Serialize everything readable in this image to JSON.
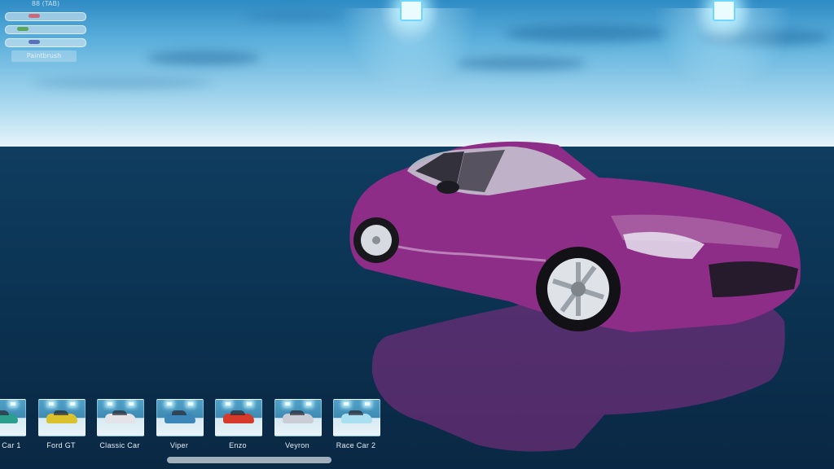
{
  "debug_panel": {
    "caption": "88 (TAB)",
    "sliders": [
      {
        "name": "red",
        "color": "#c86a7a"
      },
      {
        "name": "green",
        "color": "#5aa55a"
      },
      {
        "name": "blue",
        "color": "#5a70b8"
      }
    ],
    "button_label": "Paintbrush"
  },
  "current_car": {
    "paint_color": "#8e2d87"
  },
  "car_selector": {
    "items": [
      {
        "label": "Car 1",
        "paint": "#2c9e8e"
      },
      {
        "label": "Ford GT",
        "paint": "#d9c22e"
      },
      {
        "label": "Classic Car",
        "paint": "#e4e4e8"
      },
      {
        "label": "Viper",
        "paint": "#3d86b8"
      },
      {
        "label": "Enzo",
        "paint": "#d63a2a"
      },
      {
        "label": "Veyron",
        "paint": "#c9ced6"
      },
      {
        "label": "Race Car 2",
        "paint": "#a9dff0"
      }
    ]
  }
}
